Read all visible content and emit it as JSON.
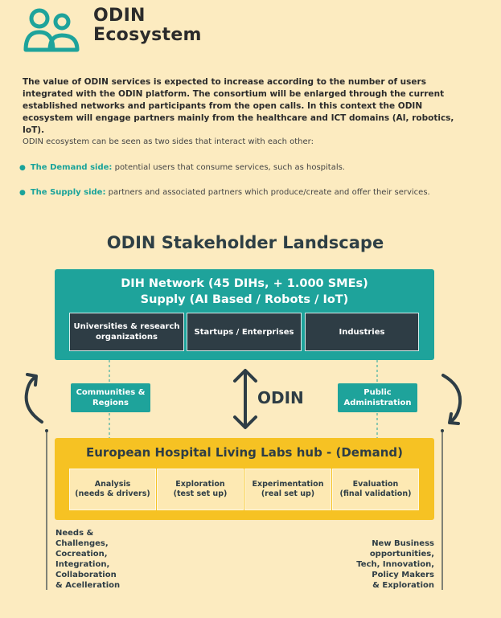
{
  "header": {
    "title_line1": "ODIN",
    "title_line2": "Ecosystem",
    "logo_icon": "people-icon",
    "accent_color": "#1ea39b"
  },
  "intro": "The value of ODIN services is expected to increase according to the number of users integrated with the ODIN platform. The consortium will be enlarged through the current established networks and participants from the open calls. In this context the ODIN ecosystem will engage partners mainly from the healthcare and ICT domains (AI, robotics, IoT).",
  "sides_intro": "ODIN ecosystem can be seen as two sides that interact with each other:",
  "bullets": [
    {
      "term": "The Demand side:",
      "text": "potential users that consume services, such as hospitals."
    },
    {
      "term": "The Supply side:",
      "text": "partners and associated partners which produce/create and offer their services."
    }
  ],
  "landscape": {
    "title": "ODIN Stakeholder Landscape",
    "supply": {
      "line1": "DIH Network (45 DIHs, + 1.000 SMEs)",
      "line2": "Supply (AI Based / Robots / IoT)",
      "boxes": [
        "Universities & research organizations",
        "Startups / Enterprises",
        "Industries"
      ],
      "color": "#1ea39b"
    },
    "middle": {
      "left_box": "Communities & Regions",
      "right_box": "Public Administration",
      "center_label": "ODIN"
    },
    "demand": {
      "title": "European Hospital Living Labs hub - (Demand)",
      "boxes": [
        {
          "name": "Analysis",
          "sub": "(needs & drivers)"
        },
        {
          "name": "Exploration",
          "sub": "(test set up)"
        },
        {
          "name": "Experimentation",
          "sub": "(real set up)"
        },
        {
          "name": "Evaluation",
          "sub": "(final validation)"
        }
      ],
      "color": "#f6c223"
    },
    "left_notes": [
      "Needs &",
      "Challenges,",
      "Cocreation,",
      "Integration,",
      "Collaboration",
      "& Acelleration"
    ],
    "right_notes": [
      "New Business",
      "opportunities,",
      "Tech, Innovation,",
      "Policy Makers",
      "& Exploration"
    ]
  }
}
